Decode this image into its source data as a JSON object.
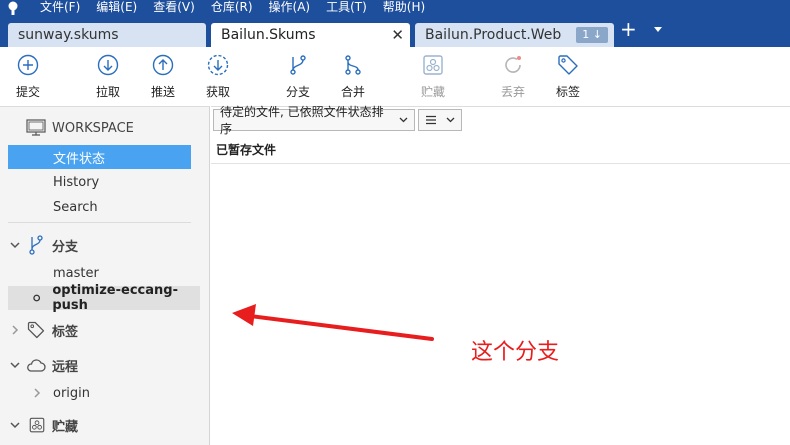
{
  "menu": {
    "items": [
      "文件(F)",
      "编辑(E)",
      "查看(V)",
      "仓库(R)",
      "操作(A)",
      "工具(T)",
      "帮助(H)"
    ]
  },
  "tabs": [
    {
      "label": "sunway.skums",
      "active": false
    },
    {
      "label": "Bailun.Skums",
      "active": true
    },
    {
      "label": "Bailun.Product.Web",
      "active": false,
      "badge": "1 ↓"
    }
  ],
  "toolbar": {
    "commit": "提交",
    "pull": "拉取",
    "push": "推送",
    "fetch": "获取",
    "branch": "分支",
    "merge": "合并",
    "stash": "贮藏",
    "discard": "丢弃",
    "tag": "标签"
  },
  "sidebar": {
    "workspace": "WORKSPACE",
    "workspace_items": [
      "文件状态",
      "History",
      "Search"
    ],
    "branches_header": "分支",
    "branches": [
      "master",
      "optimize-eccang-push"
    ],
    "tags_header": "标签",
    "remotes_header": "远程",
    "remotes": [
      "origin"
    ],
    "stashes_header": "贮藏"
  },
  "main": {
    "filter_label": "待定的文件, 已依照文件状态排序",
    "staged_header": "已暂存文件"
  },
  "annotation": {
    "text": "这个分支"
  },
  "colors": {
    "titlebar": "#1e4f9c",
    "selection": "#4aa3f0",
    "annotation": "#e81d1d",
    "icon_blue": "#2a6ebd"
  }
}
